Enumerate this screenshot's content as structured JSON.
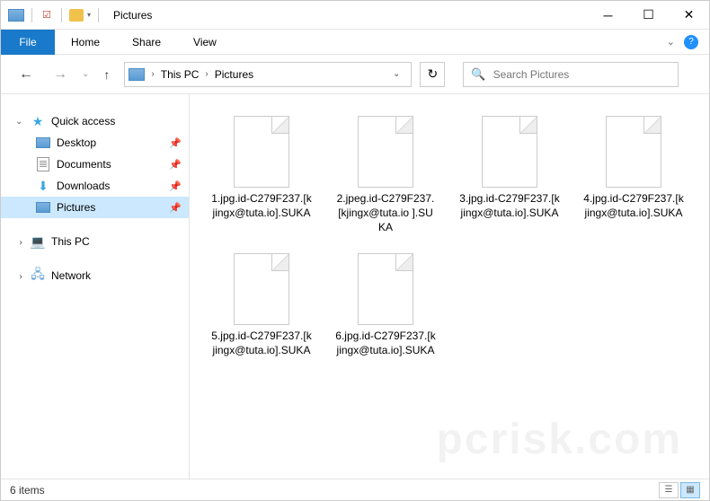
{
  "titlebar": {
    "title": "Pictures"
  },
  "ribbon": {
    "file": "File",
    "tabs": [
      "Home",
      "Share",
      "View"
    ]
  },
  "breadcrumb": {
    "parts": [
      "This PC",
      "Pictures"
    ]
  },
  "search": {
    "placeholder": "Search Pictures"
  },
  "navpane": {
    "quickaccess": {
      "label": "Quick access",
      "items": [
        {
          "label": "Desktop",
          "icon": "desktop"
        },
        {
          "label": "Documents",
          "icon": "documents"
        },
        {
          "label": "Downloads",
          "icon": "downloads"
        },
        {
          "label": "Pictures",
          "icon": "pictures",
          "selected": true
        }
      ]
    },
    "thispc": {
      "label": "This PC"
    },
    "network": {
      "label": "Network"
    }
  },
  "files": [
    {
      "name": "1.jpg.id-C279F237.[kjingx@tuta.io].SUKA"
    },
    {
      "name": "2.jpeg.id-C279F237.[kjingx@tuta.io ].SUKA"
    },
    {
      "name": "3.jpg.id-C279F237.[kjingx@tuta.io].SUKA"
    },
    {
      "name": "4.jpg.id-C279F237.[kjingx@tuta.io].SUKA"
    },
    {
      "name": "5.jpg.id-C279F237.[kjingx@tuta.io].SUKA"
    },
    {
      "name": "6.jpg.id-C279F237.[kjingx@tuta.io].SUKA"
    }
  ],
  "statusbar": {
    "count": "6 items"
  }
}
